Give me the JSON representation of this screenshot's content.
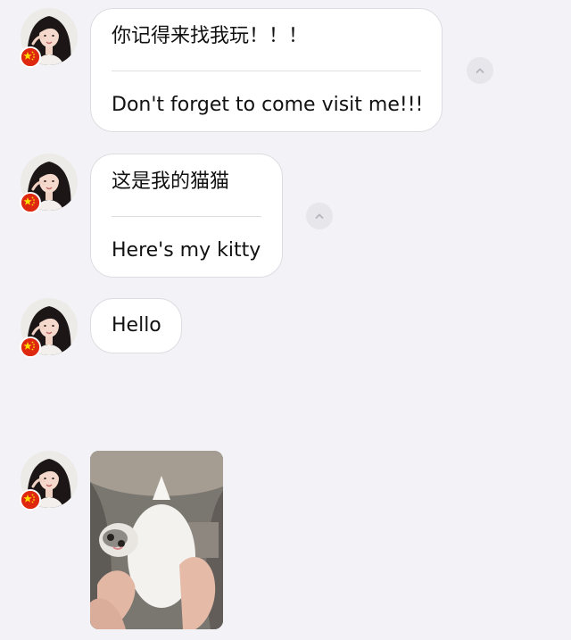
{
  "messages": [
    {
      "original": "你记得来找我玩！！！",
      "translation": "Don't forget to come visit me!!!"
    },
    {
      "original": "这是我的猫猫",
      "translation": "Here's my kitty"
    },
    {
      "text": "Hello"
    },
    {
      "image": "kitten-photo"
    }
  ],
  "icons": {
    "collapse": "chevron-up-icon",
    "flag": "china-flag-icon",
    "avatar": "contact-avatar"
  },
  "colors": {
    "background": "#f3f3f7",
    "bubble": "#ffffff",
    "bubble_border": "#dcdce2",
    "flag_red": "#de2910",
    "flag_yellow": "#ffde00"
  }
}
